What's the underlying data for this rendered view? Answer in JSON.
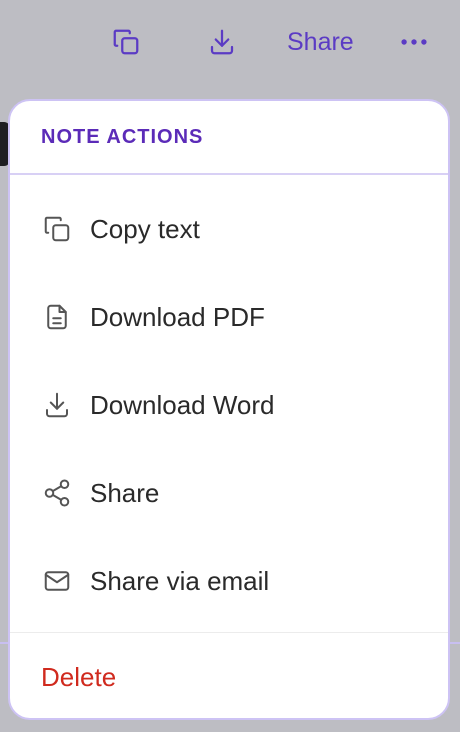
{
  "toolbar": {
    "copy_icon": "copy-icon",
    "download_icon": "download-icon",
    "share_label": "Share",
    "more_icon": "more-horizontal-icon"
  },
  "menu": {
    "header": "NOTE ACTIONS",
    "items": [
      {
        "label": "Copy text",
        "icon": "copy-icon"
      },
      {
        "label": "Download PDF",
        "icon": "file-text-icon"
      },
      {
        "label": "Download Word",
        "icon": "download-icon"
      },
      {
        "label": "Share",
        "icon": "share-icon"
      },
      {
        "label": "Share via email",
        "icon": "mail-icon"
      }
    ],
    "delete_label": "Delete"
  },
  "colors": {
    "accent": "#5b3bc4",
    "header": "#5b2bb8",
    "danger": "#d02a1e",
    "backdrop": "#bdbdc3"
  }
}
